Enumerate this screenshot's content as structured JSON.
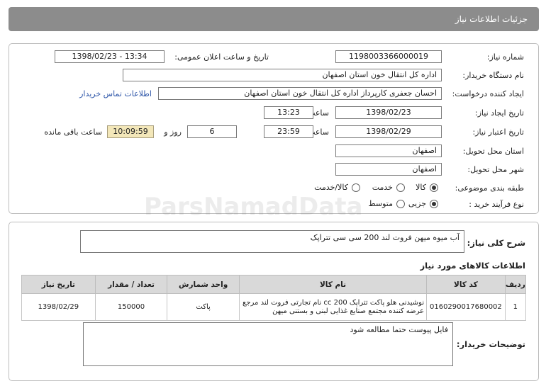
{
  "header": {
    "title": "جزئیات اطلاعات نیاز"
  },
  "form": {
    "need_number": {
      "label": "شماره نیاز:",
      "value": "1198003366000019"
    },
    "announce_datetime": {
      "label": "تاریخ و ساعت اعلان عمومی:",
      "value": "1398/02/23 - 13:34"
    },
    "buyer_org": {
      "label": "نام دستگاه خریدار:",
      "value": "اداره کل انتقال خون استان اصفهان"
    },
    "requester": {
      "label": "ایجاد کننده درخواست:",
      "value": "احسان جعفری کارپرداز اداره کل انتقال خون استان اصفهان"
    },
    "buyer_contact_link": "اطلاعات تماس خریدار",
    "created": {
      "label": "تاریخ ایجاد نیاز:",
      "date": "1398/02/23",
      "time_label": "ساعت",
      "time": "13:23"
    },
    "validity": {
      "label": "تاریخ اعتبار نیاز:",
      "date": "1398/02/29",
      "time_label": "ساعت",
      "time": "23:59",
      "days": "6",
      "days_label": "روز و",
      "remaining": "10:09:59",
      "remaining_label": "ساعت باقی مانده"
    },
    "delivery_province": {
      "label": "استان محل تحویل:",
      "value": "اصفهان"
    },
    "delivery_city": {
      "label": "شهر محل تحویل:",
      "value": "اصفهان"
    },
    "category": {
      "label": "طبقه بندی موضوعی:",
      "options": [
        "کالا",
        "خدمت",
        "کالا/خدمت"
      ],
      "selected": "کالا"
    },
    "process_type": {
      "label": "نوع فرآیند خرید :",
      "options": [
        "جزیی",
        "متوسط"
      ],
      "selected": "جزیی"
    }
  },
  "description": {
    "general_label": "شرح کلی نیاز:",
    "general_value": "آب میوه میهن فروت لند 200 سی سی تتراپک",
    "goods_section_title": "اطلاعات کالاهای مورد نیاز",
    "table": {
      "headers": [
        "ردیف",
        "کد کالا",
        "نام کالا",
        "واحد شمارش",
        "تعداد / مقدار",
        "تاریخ نیاز"
      ],
      "rows": [
        {
          "row": "1",
          "code": "0160290017680002",
          "name": "نوشیدنی هلو پاکت تتراپک 200 cc نام تجارتی فروت لند مرجع عرضه کننده مجتمع صنایع غذایی لبنی و بستنی میهن",
          "unit": "پاکت",
          "quantity": "150000",
          "date": "1398/02/29"
        }
      ]
    },
    "buyer_notes_label": "توضیحات خریدار:",
    "buyer_notes_value": "فایل پیوست حتما مطالعه شود"
  }
}
